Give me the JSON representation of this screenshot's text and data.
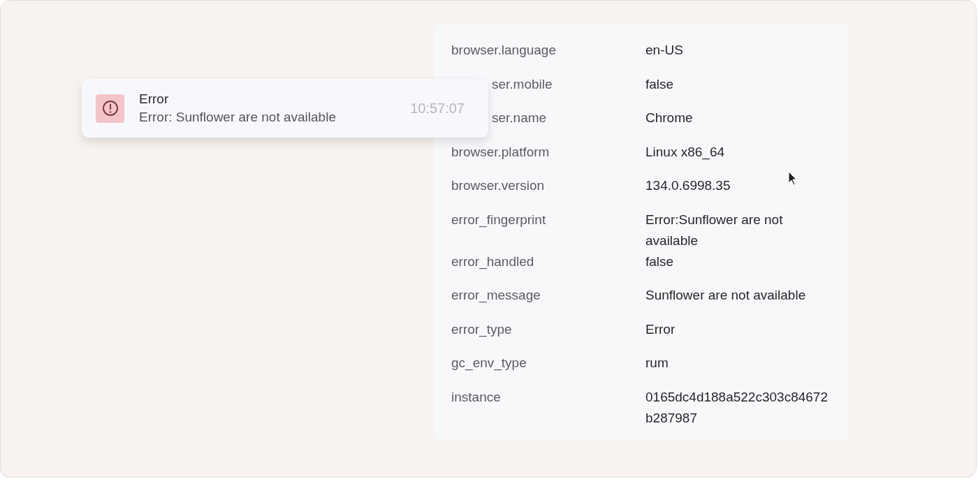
{
  "toast": {
    "title": "Error",
    "message": "Error: Sunflower are not available",
    "time": "10:57:07"
  },
  "attributes": [
    {
      "key": "browser.language",
      "value": "en-US",
      "partially_covered": false
    },
    {
      "key": "ser.mobile",
      "value": "false",
      "partially_covered": true
    },
    {
      "key": "ser.name",
      "value": "Chrome",
      "partially_covered": true
    },
    {
      "key": "browser.platform",
      "value": "Linux x86_64",
      "partially_covered": false
    },
    {
      "key": "browser.version",
      "value": "134.0.6998.35",
      "partially_covered": false
    },
    {
      "key": "error_fingerprint",
      "value": "Error:Sunflower are not available",
      "partially_covered": false
    },
    {
      "key": "error_handled",
      "value": "false",
      "partially_covered": false
    },
    {
      "key": "error_message",
      "value": "Sunflower are not available",
      "partially_covered": false
    },
    {
      "key": "error_type",
      "value": "Error",
      "partially_covered": false
    },
    {
      "key": "gc_env_type",
      "value": "rum",
      "partially_covered": false
    },
    {
      "key": "instance",
      "value": "0165dc4d188a522c303c84672b287987",
      "partially_covered": false
    }
  ]
}
